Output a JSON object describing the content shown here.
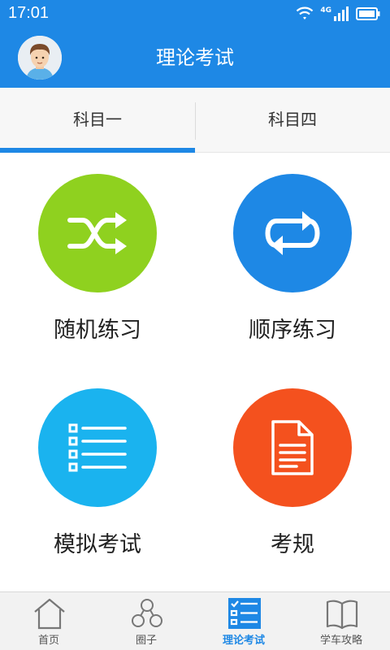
{
  "status": {
    "time": "17:01",
    "network_label": "4G"
  },
  "header": {
    "title": "理论考试"
  },
  "tabs": [
    {
      "label": "科目一",
      "active": true
    },
    {
      "label": "科目四",
      "active": false
    }
  ],
  "modes": [
    {
      "label": "随机练习",
      "icon": "shuffle-icon",
      "color": "#8fd11f"
    },
    {
      "label": "顺序练习",
      "icon": "repeat-icon",
      "color": "#1e88e5"
    },
    {
      "label": "模拟考试",
      "icon": "list-icon",
      "color": "#1ab3ef"
    },
    {
      "label": "考规",
      "icon": "document-icon",
      "color": "#f4511e"
    }
  ],
  "bottom_nav": [
    {
      "label": "首页",
      "icon": "home-icon",
      "active": false
    },
    {
      "label": "圈子",
      "icon": "circles-icon",
      "active": false
    },
    {
      "label": "理论考试",
      "icon": "checklist-icon",
      "active": true
    },
    {
      "label": "学车攻略",
      "icon": "book-icon",
      "active": false
    }
  ],
  "colors": {
    "primary": "#1e88e5",
    "nav_bg": "#f2f2f2"
  }
}
